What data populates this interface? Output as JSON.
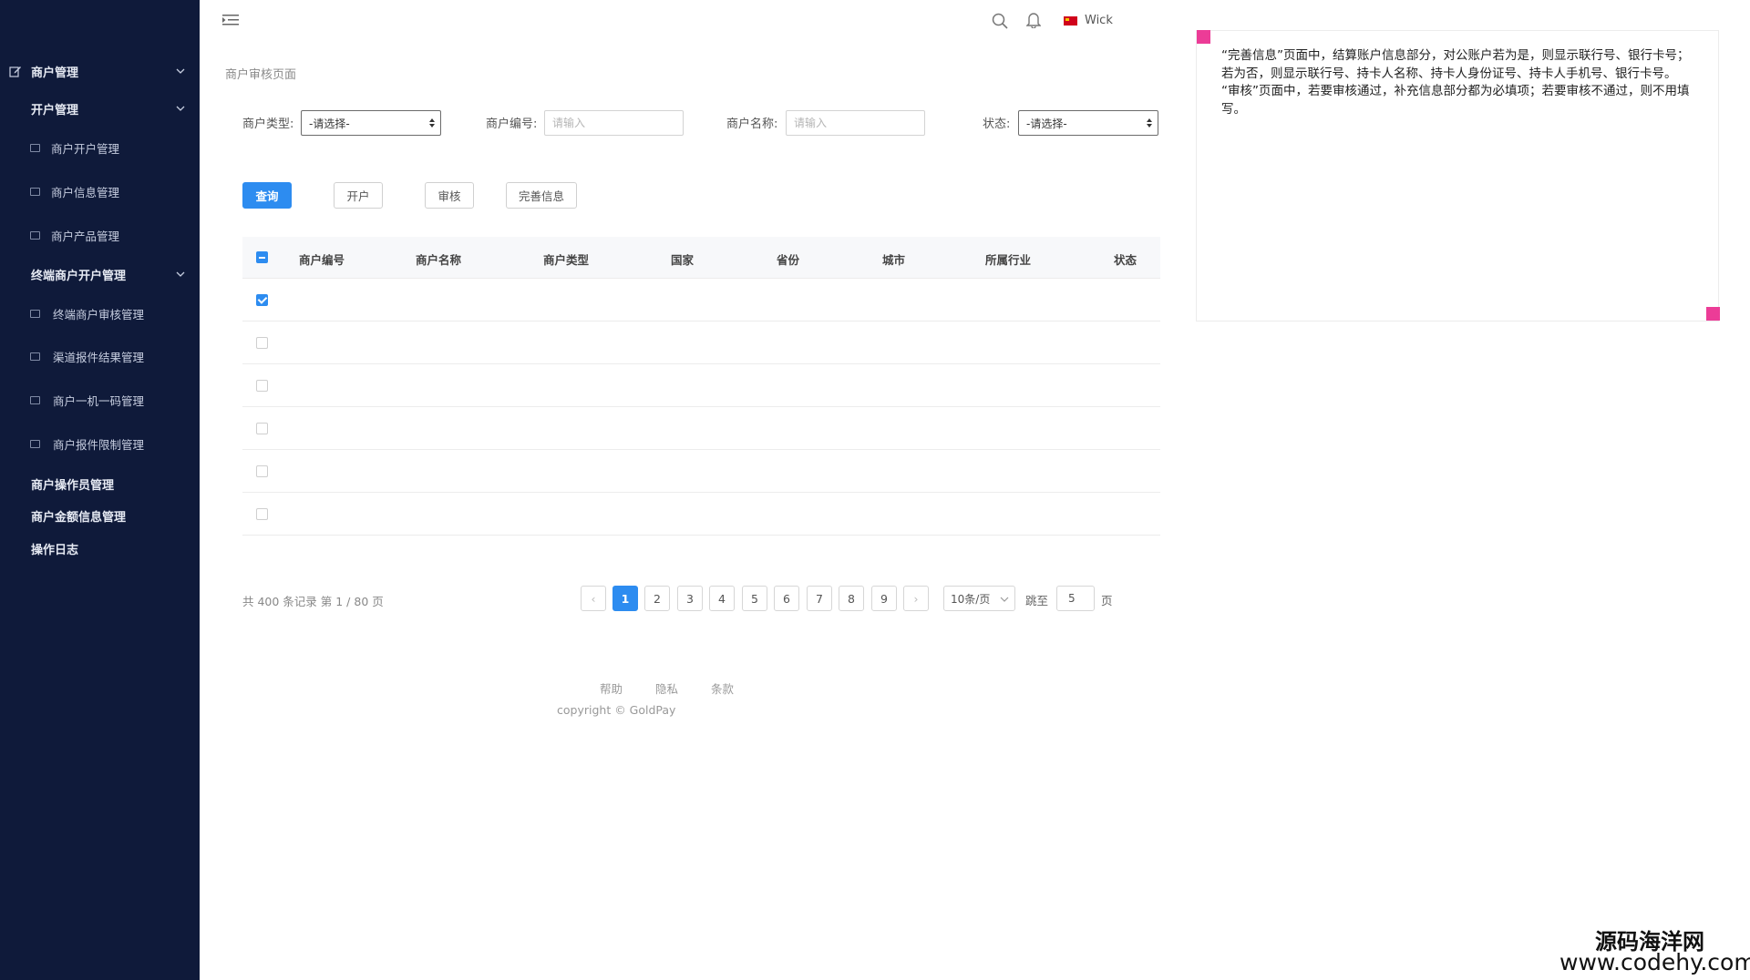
{
  "sidebar": {
    "groups": [
      {
        "label": "商户管理",
        "icon": "edit-icon"
      },
      {
        "label": "开户管理"
      },
      {
        "label": "终端商户开户管理"
      }
    ],
    "items": [
      {
        "label": "商户开户管理"
      },
      {
        "label": "商户信息管理"
      },
      {
        "label": "商户产品管理"
      },
      {
        "label": "终端商户审核管理"
      },
      {
        "label": "渠道报件结果管理"
      },
      {
        "label": "商户一机一码管理"
      },
      {
        "label": "商户报件限制管理"
      }
    ],
    "plain": [
      {
        "label": "商户操作员管理"
      },
      {
        "label": "商户金额信息管理"
      },
      {
        "label": "操作日志"
      }
    ]
  },
  "topbar": {
    "user": "Wick",
    "icons": [
      "menu-fold-icon",
      "search-icon",
      "bell-icon",
      "china-flag-icon"
    ]
  },
  "breadcrumb": "商户审核页面",
  "filters": {
    "merchant_type": {
      "label": "商户类型:",
      "value": "-请选择-"
    },
    "merchant_no": {
      "label": "商户编号:",
      "placeholder": "请输入"
    },
    "merchant_name": {
      "label": "商户名称:",
      "placeholder": "请输入"
    },
    "status": {
      "label": "状态:",
      "value": "-请选择-"
    }
  },
  "actions": {
    "query": "查询",
    "open": "开户",
    "review": "审核",
    "complete": "完善信息"
  },
  "table": {
    "columns": [
      "商户编号",
      "商户名称",
      "商户类型",
      "国家",
      "省份",
      "城市",
      "所属行业",
      "状态"
    ],
    "header_checkbox": "partial",
    "rows": [
      {
        "checked": true
      },
      {
        "checked": false
      },
      {
        "checked": false
      },
      {
        "checked": false
      },
      {
        "checked": false
      },
      {
        "checked": false
      }
    ]
  },
  "pagination": {
    "summary": "共 400 条记录 第 1 / 80 页",
    "pages": [
      "1",
      "2",
      "3",
      "4",
      "5",
      "6",
      "7",
      "8",
      "9"
    ],
    "current": "1",
    "prev": "‹",
    "next": "›",
    "page_size": "10条/页",
    "jump_label": "跳至",
    "jump_value": "5",
    "jump_suffix": "页"
  },
  "footer": {
    "links": [
      "帮助",
      "隐私",
      "条款"
    ],
    "copyright": "copyright © GoldPay"
  },
  "annotation": {
    "lines": [
      "“完善信息”页面中，结算账户信息部分，对公账户若为是，则显示联行号、银行卡号；若为否，则显示联行号、持卡人名称、持卡人身份证号、持卡人手机号、银行卡号。",
      "“审核”页面中，若要审核通过，补充信息部分都为必填项；若要审核不通过，则不用填写。"
    ],
    "marker_color": "#ec3c97"
  },
  "watermark": {
    "cn": "源码海洋网",
    "url": "www.codehy.com"
  },
  "colors": {
    "sidebar_bg": "#0f1a3a",
    "primary": "#2d8cf0"
  }
}
